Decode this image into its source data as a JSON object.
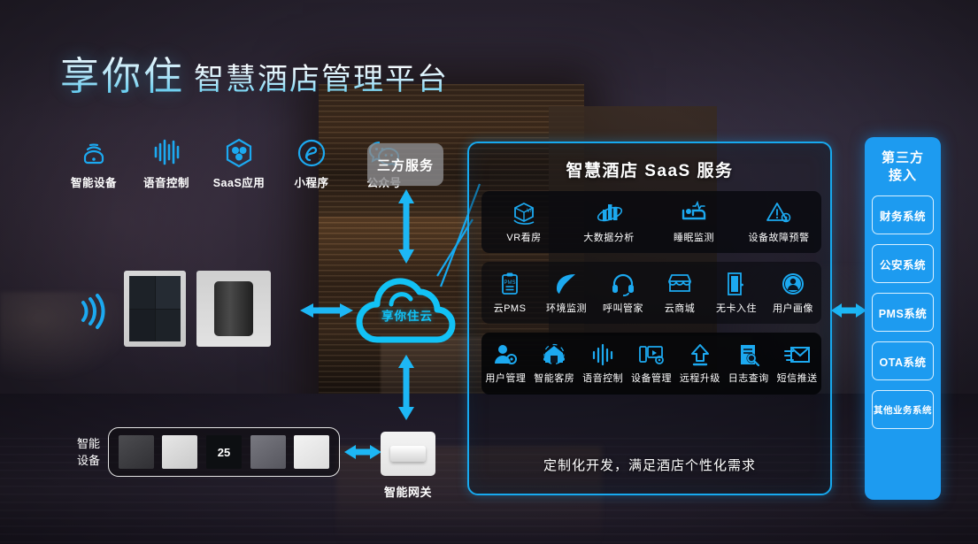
{
  "title": {
    "brand": "享你住",
    "subtitle": "智慧酒店管理平台"
  },
  "colors": {
    "accent": "#1d9bf0",
    "accent_bright": "#12c2f5",
    "panel_border": "#17a9ef",
    "gray_box": "#8a8a8c"
  },
  "top_channels": [
    {
      "icon": "smart-device-icon",
      "label": "智能设备"
    },
    {
      "icon": "voice-control-icon",
      "label": "语音控制"
    },
    {
      "icon": "saas-app-icon",
      "label": "SaaS应用"
    },
    {
      "icon": "mini-program-icon",
      "label": "小程序"
    },
    {
      "icon": "wechat-official-icon",
      "label": "公众号"
    }
  ],
  "third_party_service_box": {
    "label": "三方服务"
  },
  "cloud": {
    "label": "享你住云",
    "icon": "cloud-icon"
  },
  "saas": {
    "title": "智慧酒店 SaaS 服务",
    "footer": "定制化开发，满足酒店个性化需求",
    "rows": [
      {
        "items": [
          {
            "icon": "vr-box-icon",
            "label": "VR看房"
          },
          {
            "icon": "big-data-icon",
            "label": "大数据分析"
          },
          {
            "icon": "sleep-monitor-icon",
            "label": "睡眠监测"
          },
          {
            "icon": "fault-alert-icon",
            "label": "设备故障预警"
          }
        ]
      },
      {
        "items": [
          {
            "icon": "clipboard-pms-icon",
            "label": "云PMS"
          },
          {
            "icon": "leaf-icon",
            "label": "环境监测"
          },
          {
            "icon": "headset-icon",
            "label": "呼叫管家"
          },
          {
            "icon": "store-icon",
            "label": "云商城"
          },
          {
            "icon": "door-icon",
            "label": "无卡入住"
          },
          {
            "icon": "user-profile-icon",
            "label": "用户画像"
          }
        ]
      },
      {
        "items": [
          {
            "icon": "user-settings-icon",
            "label": "用户管理"
          },
          {
            "icon": "smart-room-icon",
            "label": "智能客房"
          },
          {
            "icon": "voice-wave-icon",
            "label": "语音控制"
          },
          {
            "icon": "device-manage-icon",
            "label": "设备管理"
          },
          {
            "icon": "upgrade-arrow-icon",
            "label": "远程升级"
          },
          {
            "icon": "log-search-icon",
            "label": "日志查询"
          },
          {
            "icon": "sms-push-icon",
            "label": "短信推送"
          }
        ]
      }
    ]
  },
  "third_party_access": {
    "title_line1": "第三方",
    "title_line2": "接入",
    "items": [
      {
        "label": "财务系统"
      },
      {
        "label": "公安系统"
      },
      {
        "label": "PMS系统"
      },
      {
        "label": "OTA系统"
      },
      {
        "label": "其他业务系统"
      }
    ]
  },
  "left_devices": {
    "group_label_line1": "智能",
    "group_label_line2": "设备",
    "wifi_icon": "wireless-signal-icon",
    "photos": [
      {
        "name": "wall-panel-photo"
      },
      {
        "name": "smart-speaker-photo"
      }
    ],
    "strip_items": [
      {
        "name": "switch-panel-thumb",
        "value": ""
      },
      {
        "name": "door-lock-thumb",
        "value": ""
      },
      {
        "name": "thermostat-thumb",
        "value": "25"
      },
      {
        "name": "control-panel-thumb",
        "value": ""
      },
      {
        "name": "light-strip-thumb",
        "value": ""
      }
    ]
  },
  "gateway": {
    "label": "智能网关",
    "icon": "gateway-photo"
  },
  "arrows": [
    {
      "name": "arrow-service-to-cloud",
      "direction": "vertical"
    },
    {
      "name": "arrow-devices-to-cloud",
      "direction": "horizontal"
    },
    {
      "name": "arrow-cloud-to-gateway",
      "direction": "vertical"
    },
    {
      "name": "arrow-strip-to-gateway",
      "direction": "horizontal"
    },
    {
      "name": "arrow-saas-to-thirdparty",
      "direction": "horizontal"
    }
  ]
}
